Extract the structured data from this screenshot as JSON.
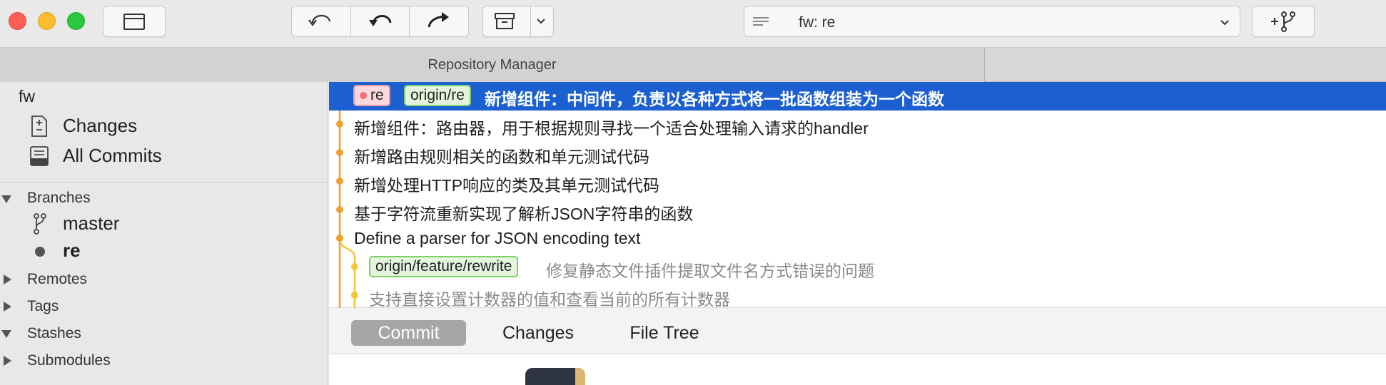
{
  "window": {
    "repo_selector_value": "fw: re",
    "tab_title": "Repository Manager"
  },
  "toolbar": {
    "icons": [
      "folder-icon",
      "fetch-icon",
      "pull-icon",
      "push-icon",
      "stash-icon",
      "chevron-down-icon",
      "lines-icon",
      "new-branch-icon"
    ]
  },
  "sidebar": {
    "repo_name": "fw",
    "workspace": [
      {
        "label": "Changes",
        "icon": "changes-icon"
      },
      {
        "label": "All Commits",
        "icon": "all-commits-icon"
      }
    ],
    "sections": {
      "branches": "Branches",
      "remotes": "Remotes",
      "tags": "Tags",
      "stashes": "Stashes",
      "submodules": "Submodules"
    },
    "branches": [
      {
        "label": "master",
        "icon": "branch-icon",
        "current": false
      },
      {
        "label": "re",
        "icon": "current-branch-dot-icon",
        "current": true
      }
    ]
  },
  "commits": [
    {
      "refs": [
        {
          "label": "re",
          "kind": "local"
        },
        {
          "label": "origin/re",
          "kind": "remote"
        }
      ],
      "message": "新增组件：中间件，负责以各种方式将一批函数组装为一个函数",
      "selected": true
    },
    {
      "refs": [],
      "message": "新增组件：路由器，用于根据规则寻找一个适合处理输入请求的handler",
      "selected": false
    },
    {
      "refs": [],
      "message": "新增路由规则相关的函数和单元测试代码",
      "selected": false
    },
    {
      "refs": [],
      "message": "新增处理HTTP响应的类及其单元测试代码",
      "selected": false
    },
    {
      "refs": [],
      "message": "基于字符流重新实现了解析JSON字符串的函数",
      "selected": false
    },
    {
      "refs": [],
      "message": "Define a parser for JSON encoding text",
      "selected": false
    },
    {
      "refs": [
        {
          "label": "origin/feature/rewrite",
          "kind": "remote"
        }
      ],
      "message": "修复静态文件插件提取文件名方式错误的问题",
      "selected": false
    },
    {
      "refs": [],
      "message": "支持直接设置计数器的值和查看当前的所有计数器",
      "selected": false
    }
  ],
  "detail_tabs": [
    "Commit",
    "Changes",
    "File Tree"
  ],
  "colors": {
    "selection": "#1b5fd1",
    "graph_main": "#f0a030",
    "graph_branch": "#f2c43a"
  }
}
